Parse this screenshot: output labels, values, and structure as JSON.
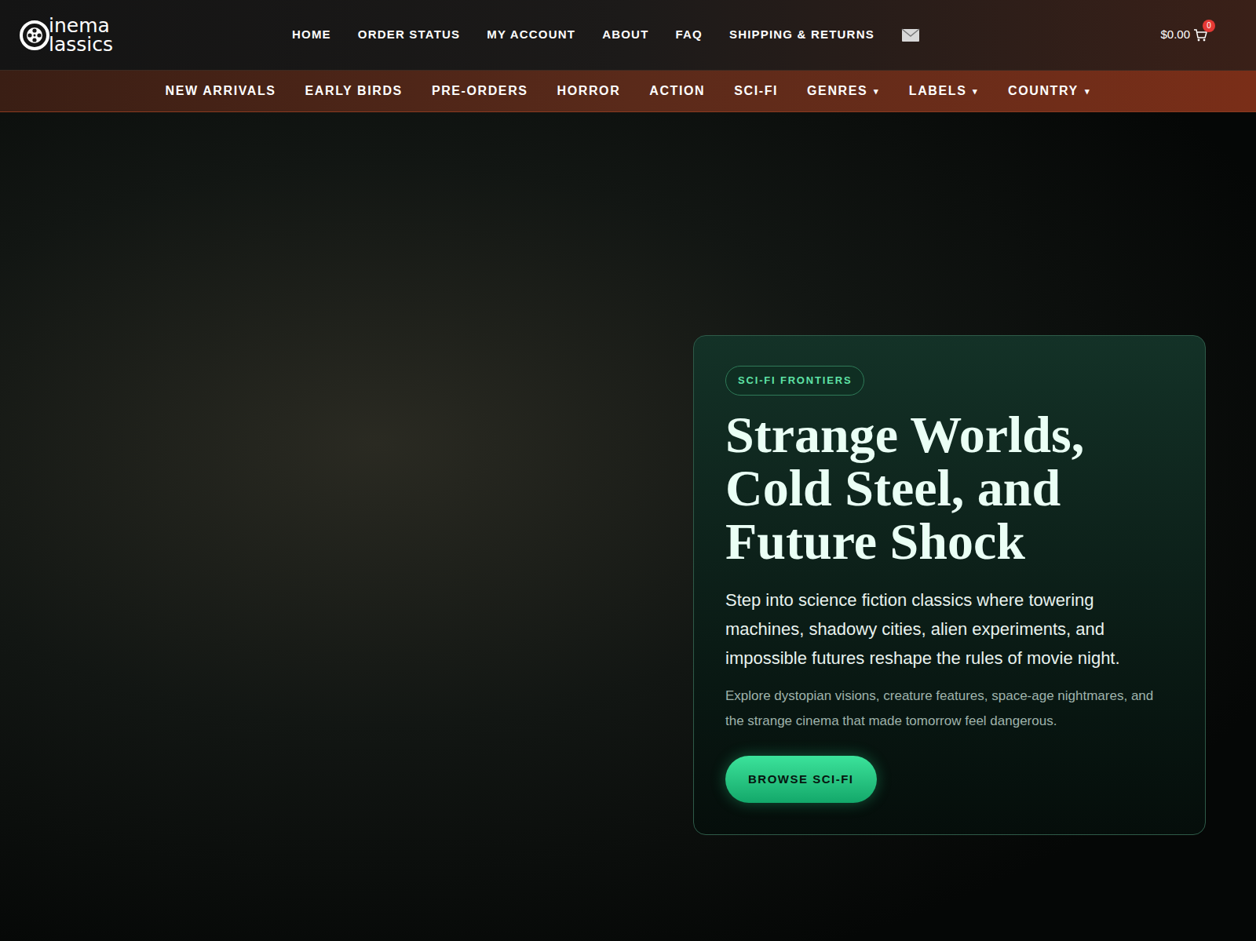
{
  "header": {
    "logo": {
      "line1": "inema",
      "line2": "lassics"
    },
    "nav": [
      {
        "label": "HOME"
      },
      {
        "label": "ORDER STATUS"
      },
      {
        "label": "MY ACCOUNT"
      },
      {
        "label": "ABOUT"
      },
      {
        "label": "FAQ"
      },
      {
        "label": "SHIPPING & RETURNS"
      }
    ],
    "cart": {
      "total": "$0.00",
      "count": "0"
    }
  },
  "categories": {
    "caret": "▾",
    "items": [
      {
        "label": "NEW ARRIVALS",
        "kind": "link"
      },
      {
        "label": "EARLY BIRDS",
        "kind": "link"
      },
      {
        "label": "PRE-ORDERS",
        "kind": "link"
      },
      {
        "label": "HORROR",
        "kind": "link"
      },
      {
        "label": "ACTION",
        "kind": "link"
      },
      {
        "label": "SCI-FI",
        "kind": "link"
      },
      {
        "label": "GENRES",
        "kind": "menu"
      },
      {
        "label": "LABELS",
        "kind": "menu"
      },
      {
        "label": "COUNTRY",
        "kind": "menu"
      }
    ]
  },
  "hero": {
    "badge": "SCI-FI FRONTIERS",
    "title": "Strange Worlds, Cold Steel, and Future Shock",
    "lead": "Step into science fiction classics where towering machines, shadowy cities, alien experiments, and impossible futures reshape the rules of movie night.",
    "sub": "Explore dystopian visions, creature features, space-age nightmares, and the strange cinema that made tomorrow feel dangerous.",
    "button": "BROWSE SCI-FI"
  }
}
